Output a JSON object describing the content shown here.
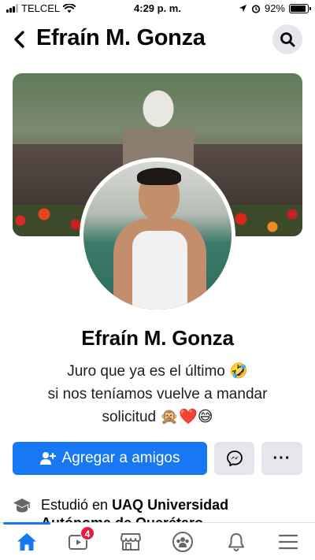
{
  "status_bar": {
    "carrier": "TELCEL",
    "time": "4:29 p. m.",
    "battery": "92%",
    "battery_level": 0.92
  },
  "header": {
    "title": "Efraín M. Gonza",
    "back_icon": "chevron-left-icon",
    "search_icon": "search-icon"
  },
  "profile": {
    "name": "Efraín M. Gonza",
    "bio_line1": "Juro que ya es el último 🤣",
    "bio_line2": "si nos teníamos vuelve a mandar",
    "bio_line3": "solicitud 🙊❤️😅"
  },
  "actions": {
    "add_friend_label": "Agregar a amigos",
    "messenger_icon": "messenger-icon",
    "more_label": "···"
  },
  "about": {
    "prefix": "Estudió en ",
    "school": "UAQ Universidad Autónoma de Querétaro"
  },
  "tab_bar": {
    "tabs": [
      {
        "icon": "home-icon",
        "active": true
      },
      {
        "icon": "watch-icon",
        "badge": "4"
      },
      {
        "icon": "marketplace-icon"
      },
      {
        "icon": "groups-icon"
      },
      {
        "icon": "notifications-icon"
      },
      {
        "icon": "menu-icon"
      }
    ]
  },
  "colors": {
    "accent": "#1877f2",
    "button_gray": "#e4e6eb",
    "badge_red": "#e41e3f"
  }
}
